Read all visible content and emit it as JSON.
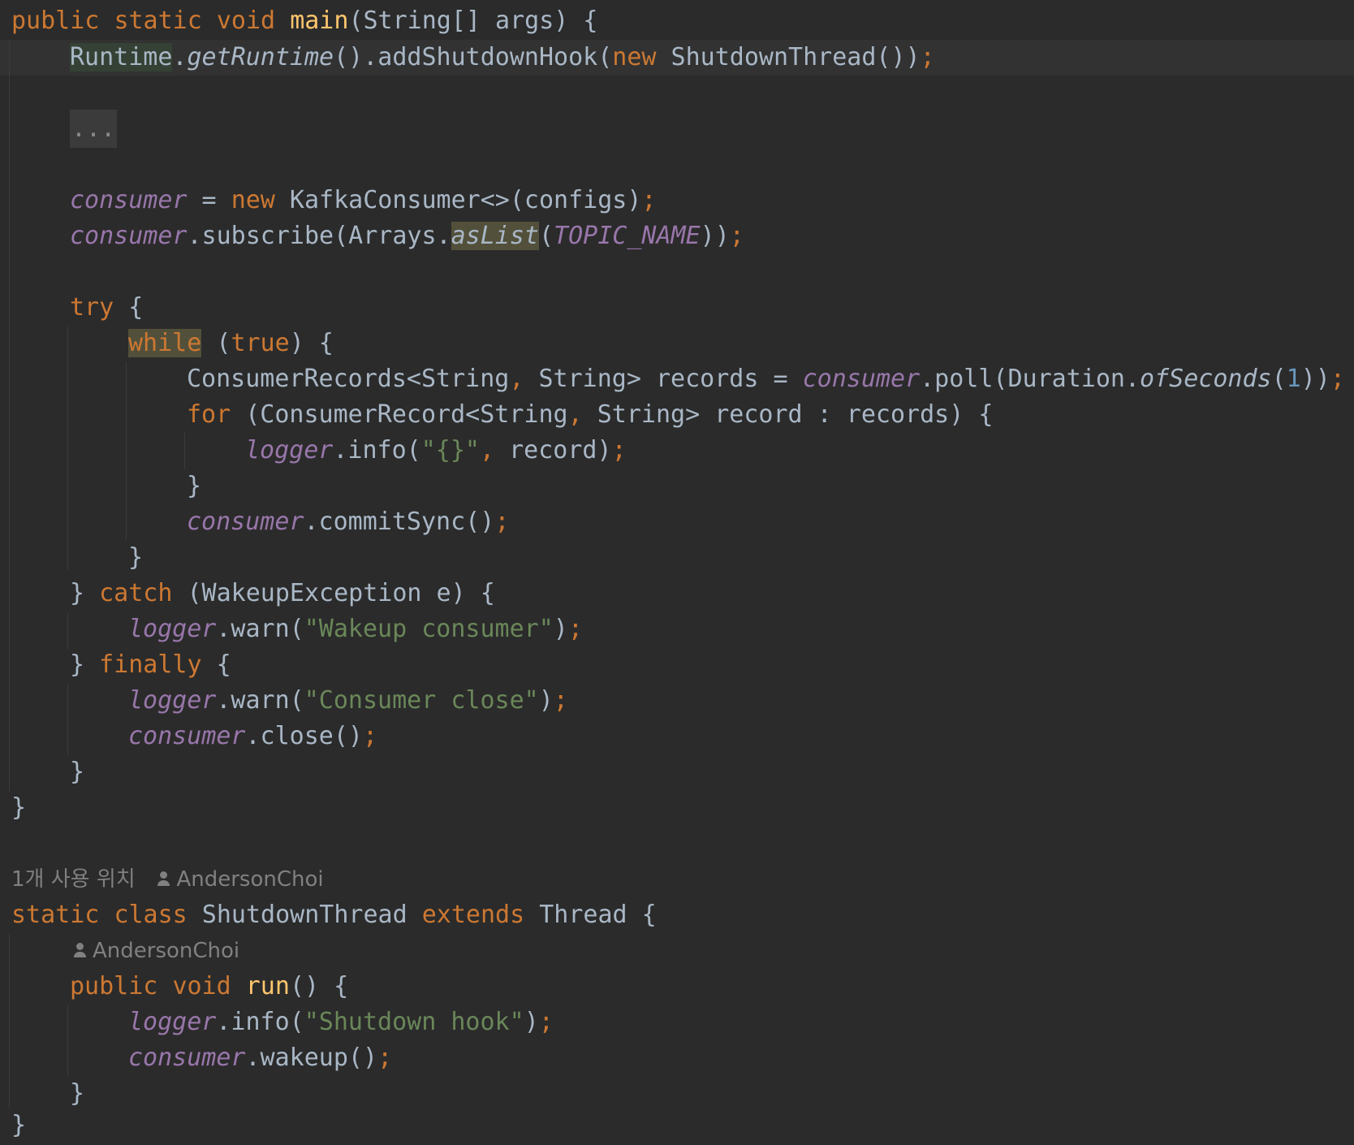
{
  "editor": {
    "lines": {
      "main_sig": {
        "public": "public",
        "static": "static",
        "void": "void",
        "name": "main",
        "params": "(String[] args) {"
      },
      "hook": {
        "runtime": "Runtime",
        "dot": ".",
        "get_runtime": "getRuntime",
        "rest": "().addShutdownHook(",
        "new": "new",
        "cls": " ShutdownThread())",
        "semi": ";"
      },
      "folded": "...",
      "consumer_assign": {
        "field": "consumer",
        "eq": " = ",
        "new": "new",
        "rest": " KafkaConsumer<>(configs)",
        "semi": ";"
      },
      "subscribe": {
        "field": "consumer",
        "call": ".subscribe(Arrays.",
        "as_list": "asList",
        "open": "(",
        "topic": "TOPIC_NAME",
        "close": "))",
        "semi": ";"
      },
      "try_open": {
        "kw": "try",
        "rest": " {"
      },
      "while_open": {
        "kw": "while",
        "open": " (",
        "true": "true",
        "rest": ") {"
      },
      "records": {
        "type1": "ConsumerRecords<String",
        "comma": ",",
        "type2": " String> records = ",
        "field": "consumer",
        "call": ".poll(Duration.",
        "of_seconds": "ofSeconds",
        "open": "(",
        "num": "1",
        "close": "))",
        "semi": ";"
      },
      "for_open": {
        "kw": "for",
        "part1": " (ConsumerRecord<String",
        "comma": ",",
        "part2": " String> record : records) {"
      },
      "logger_info": {
        "field": "logger",
        "call": ".info(",
        "str": "\"{}\"",
        "comma": ",",
        "rest": " record)",
        "semi": ";"
      },
      "for_close": "}",
      "commit": {
        "field": "consumer",
        "call": ".commitSync()",
        "semi": ";"
      },
      "while_close": "}",
      "catch": {
        "brace": "} ",
        "kw": "catch",
        "rest": " (WakeupException e) {"
      },
      "warn_wakeup": {
        "field": "logger",
        "call": ".warn(",
        "str": "\"Wakeup consumer\"",
        "close": ")",
        "semi": ";"
      },
      "finally": {
        "brace": "} ",
        "kw": "finally",
        "rest": " {"
      },
      "warn_close": {
        "field": "logger",
        "call": ".warn(",
        "str": "\"Consumer close\"",
        "close": ")",
        "semi": ";"
      },
      "close_call": {
        "field": "consumer",
        "call": ".close()",
        "semi": ";"
      },
      "finally_close": "}",
      "main_close": "}",
      "usage_hint": {
        "usages": "1개 사용 위치",
        "author": "AndersonChoi"
      },
      "class_decl": {
        "static": "static",
        "class": "class",
        "name": " ShutdownThread ",
        "extends": "extends",
        "rest": " Thread {"
      },
      "author_hint": {
        "author": "AndersonChoi"
      },
      "run_sig": {
        "public": "public",
        "void": "void",
        "name": "run",
        "rest": "() {"
      },
      "shutdown_log": {
        "field": "logger",
        "call": ".info(",
        "str": "\"Shutdown hook\"",
        "close": ")",
        "semi": ";"
      },
      "wakeup": {
        "field": "consumer",
        "call": ".wakeup()",
        "semi": ";"
      },
      "run_close": "}",
      "class_close": "}"
    }
  }
}
